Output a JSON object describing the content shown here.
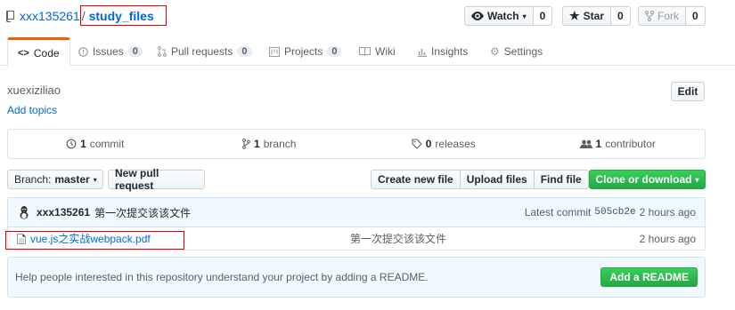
{
  "repo": {
    "owner": "xxx135261",
    "slash": "/",
    "name": "study_files"
  },
  "actions": {
    "watch": {
      "label": "Watch",
      "count": "0"
    },
    "star": {
      "label": "Star",
      "count": "0"
    },
    "fork": {
      "label": "Fork",
      "count": "0"
    }
  },
  "tabs": [
    {
      "label": "Code"
    },
    {
      "label": "Issues",
      "count": "0"
    },
    {
      "label": "Pull requests",
      "count": "0"
    },
    {
      "label": "Projects",
      "count": "0"
    },
    {
      "label": "Wiki"
    },
    {
      "label": "Insights"
    },
    {
      "label": "Settings"
    }
  ],
  "description": "xuexiziliao",
  "add_topics": "Add topics",
  "edit_label": "Edit",
  "summary": {
    "commits": {
      "count": "1",
      "label": "commit"
    },
    "branches": {
      "count": "1",
      "label": "branch"
    },
    "releases": {
      "count": "0",
      "label": "releases"
    },
    "contributors": {
      "count": "1",
      "label": "contributor"
    }
  },
  "file_nav": {
    "branch_prefix": "Branch:",
    "branch_name": "master",
    "new_pr": "New pull request",
    "create_file": "Create new file",
    "upload_files": "Upload files",
    "find_file": "Find file",
    "clone": "Clone or download"
  },
  "commit": {
    "author": "xxx135261",
    "message": "第一次提交该该文件",
    "latest_label": "Latest commit",
    "sha": "505cb2e",
    "age": "2 hours ago"
  },
  "files": [
    {
      "name": "vue.js之实战webpack.pdf",
      "message": "第一次提交该该文件",
      "age": "2 hours ago"
    }
  ],
  "readme": {
    "text": "Help people interested in this repository understand your project by adding a README.",
    "button": "Add a README"
  },
  "colors": {
    "link": "#0366d6",
    "accent_tab": "#e36209",
    "primary_green": "#28a745",
    "highlight_box": "#dd0000"
  }
}
